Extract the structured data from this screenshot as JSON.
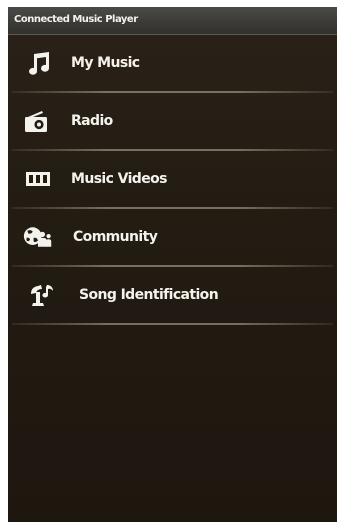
{
  "app": {
    "title": "Connected Music Player"
  },
  "menu": {
    "items": [
      {
        "label": "My Music",
        "icon": "music-note-icon"
      },
      {
        "label": "Radio",
        "icon": "radio-icon"
      },
      {
        "label": "Music Videos",
        "icon": "film-strip-icon"
      },
      {
        "label": "Community",
        "icon": "community-globe-icon"
      },
      {
        "label": "Song Identification",
        "icon": "song-identification-icon"
      }
    ]
  },
  "colors": {
    "background": "#231c13",
    "titlebar": "#3e3d39",
    "text": "#f4f2ec",
    "separator": "#beb4a0"
  }
}
